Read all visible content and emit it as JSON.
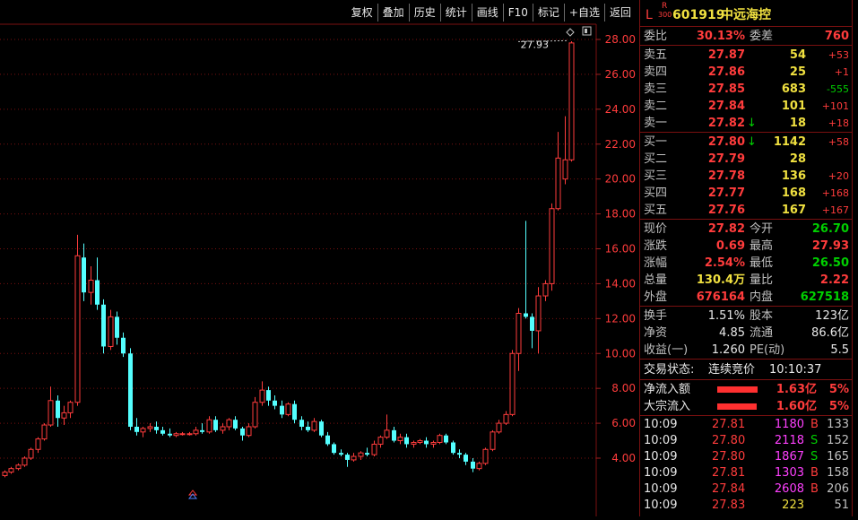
{
  "toolbar": {
    "items": [
      "复权",
      "叠加",
      "历史",
      "统计",
      "画线",
      "F10",
      "标记",
      "+自选",
      "返回"
    ]
  },
  "chart": {
    "y_labels": [
      "28.00",
      "26.00",
      "24.00",
      "22.00",
      "20.00",
      "18.00",
      "16.00",
      "14.00",
      "12.00",
      "10.00",
      "8.00",
      "6.00",
      "4.00"
    ],
    "high_marker": "27.93",
    "up_color": "#ff3c3c",
    "down_color": "#54ffff"
  },
  "stock": {
    "l": "L",
    "r": "R",
    "r_sub": "300",
    "code": "601919",
    "name": "中远海控"
  },
  "order_ratio": {
    "label1": "委比",
    "value1": "30.13%",
    "label2": "委差",
    "value2": "760"
  },
  "asks": [
    {
      "label": "卖五",
      "price": "27.87",
      "volume": "54",
      "change": "+53",
      "arrow": ""
    },
    {
      "label": "卖四",
      "price": "27.86",
      "volume": "25",
      "change": "+1",
      "arrow": ""
    },
    {
      "label": "卖三",
      "price": "27.85",
      "volume": "683",
      "change": "-555",
      "arrow": ""
    },
    {
      "label": "卖二",
      "price": "27.84",
      "volume": "101",
      "change": "+101",
      "arrow": ""
    },
    {
      "label": "卖一",
      "price": "27.82",
      "volume": "18",
      "change": "+18",
      "arrow": "↓"
    }
  ],
  "bids": [
    {
      "label": "买一",
      "price": "27.80",
      "volume": "1142",
      "change": "+58",
      "arrow": "↓"
    },
    {
      "label": "买二",
      "price": "27.79",
      "volume": "28",
      "change": "",
      "arrow": ""
    },
    {
      "label": "买三",
      "price": "27.78",
      "volume": "136",
      "change": "+20",
      "arrow": ""
    },
    {
      "label": "买四",
      "price": "27.77",
      "volume": "168",
      "change": "+168",
      "arrow": ""
    },
    {
      "label": "买五",
      "price": "27.76",
      "volume": "167",
      "change": "+167",
      "arrow": ""
    }
  ],
  "quote": [
    {
      "l1": "现价",
      "v1": "27.82",
      "c1": "red",
      "l2": "今开",
      "v2": "26.70",
      "c2": "green"
    },
    {
      "l1": "涨跌",
      "v1": "0.69",
      "c1": "red",
      "l2": "最高",
      "v2": "27.93",
      "c2": "red"
    },
    {
      "l1": "涨幅",
      "v1": "2.54%",
      "c1": "red",
      "l2": "最低",
      "v2": "26.50",
      "c2": "green"
    },
    {
      "l1": "总量",
      "v1": "130.4万",
      "c1": "yellow",
      "l2": "量比",
      "v2": "2.22",
      "c2": "red"
    },
    {
      "l1": "外盘",
      "v1": "676164",
      "c1": "red",
      "l2": "内盘",
      "v2": "627518",
      "c2": "green"
    }
  ],
  "fundamentals": [
    {
      "l1": "换手",
      "v1": "1.51%",
      "l2": "股本",
      "v2": "123亿"
    },
    {
      "l1": "净资",
      "v1": "4.85",
      "l2": "流通",
      "v2": "86.6亿"
    },
    {
      "l1": "收益(一)",
      "v1": "1.260",
      "l2": "PE(动)",
      "v2": "5.5"
    }
  ],
  "status": {
    "label": "交易状态:",
    "value": "连续竞价",
    "time": "10:10:37"
  },
  "flows": [
    {
      "label": "净流入额",
      "amount": "1.63亿",
      "pct": "5%",
      "bar": 0.9
    },
    {
      "label": "大宗流入",
      "amount": "1.60亿",
      "pct": "5%",
      "bar": 0.88
    }
  ],
  "ticks": [
    {
      "time": "10:09",
      "price": "27.81",
      "vol": "1180",
      "side": "B",
      "count": "133"
    },
    {
      "time": "10:09",
      "price": "27.80",
      "vol": "2118",
      "side": "S",
      "count": "152"
    },
    {
      "time": "10:09",
      "price": "27.80",
      "vol": "1867",
      "side": "S",
      "count": "165"
    },
    {
      "time": "10:09",
      "price": "27.81",
      "vol": "1303",
      "side": "B",
      "count": "158"
    },
    {
      "time": "10:09",
      "price": "27.84",
      "vol": "2608",
      "side": "B",
      "count": "206"
    },
    {
      "time": "10:09",
      "price": "27.83",
      "vol": "223",
      "side": "",
      "count": "51"
    }
  ],
  "candles": [
    {
      "o": 3.0,
      "h": 3.3,
      "l": 2.9,
      "c": 3.2
    },
    {
      "o": 3.2,
      "h": 3.5,
      "l": 3.1,
      "c": 3.4
    },
    {
      "o": 3.4,
      "h": 3.7,
      "l": 3.3,
      "c": 3.6
    },
    {
      "o": 3.6,
      "h": 4.1,
      "l": 3.5,
      "c": 4.0
    },
    {
      "o": 4.0,
      "h": 4.6,
      "l": 3.9,
      "c": 4.5
    },
    {
      "o": 4.5,
      "h": 5.2,
      "l": 4.3,
      "c": 5.1
    },
    {
      "o": 5.1,
      "h": 6.0,
      "l": 5.0,
      "c": 5.9
    },
    {
      "o": 5.9,
      "h": 8.1,
      "l": 5.8,
      "c": 7.3
    },
    {
      "o": 7.3,
      "h": 7.6,
      "l": 5.8,
      "c": 6.3
    },
    {
      "o": 6.3,
      "h": 7.0,
      "l": 5.9,
      "c": 6.6
    },
    {
      "o": 6.6,
      "h": 7.3,
      "l": 6.3,
      "c": 7.2
    },
    {
      "o": 7.2,
      "h": 16.8,
      "l": 7.0,
      "c": 15.6
    },
    {
      "o": 15.5,
      "h": 16.3,
      "l": 13.0,
      "c": 13.5
    },
    {
      "o": 13.5,
      "h": 15.0,
      "l": 12.8,
      "c": 14.2
    },
    {
      "o": 14.2,
      "h": 15.5,
      "l": 12.5,
      "c": 12.8
    },
    {
      "o": 12.8,
      "h": 13.1,
      "l": 10.0,
      "c": 10.4
    },
    {
      "o": 10.4,
      "h": 12.5,
      "l": 10.2,
      "c": 12.1
    },
    {
      "o": 12.1,
      "h": 12.4,
      "l": 10.5,
      "c": 10.9
    },
    {
      "o": 10.9,
      "h": 11.2,
      "l": 9.8,
      "c": 10.0
    },
    {
      "o": 10.0,
      "h": 10.3,
      "l": 5.6,
      "c": 5.8
    },
    {
      "o": 5.8,
      "h": 6.3,
      "l": 5.3,
      "c": 5.5
    },
    {
      "o": 5.5,
      "h": 5.8,
      "l": 5.2,
      "c": 5.7
    },
    {
      "o": 5.7,
      "h": 6.0,
      "l": 5.5,
      "c": 5.8
    },
    {
      "o": 5.8,
      "h": 6.1,
      "l": 5.4,
      "c": 5.6
    },
    {
      "o": 5.6,
      "h": 5.8,
      "l": 5.3,
      "c": 5.4
    },
    {
      "o": 5.4,
      "h": 5.7,
      "l": 5.2,
      "c": 5.3
    },
    {
      "o": 5.3,
      "h": 5.5,
      "l": 5.2,
      "c": 5.4
    },
    {
      "o": 5.4,
      "h": 5.5,
      "l": 5.3,
      "c": 5.4
    },
    {
      "o": 5.4,
      "h": 5.5,
      "l": 5.3,
      "c": 5.4
    },
    {
      "o": 5.4,
      "h": 5.8,
      "l": 5.3,
      "c": 5.6
    },
    {
      "o": 5.6,
      "h": 6.0,
      "l": 5.4,
      "c": 5.5
    },
    {
      "o": 5.5,
      "h": 6.4,
      "l": 5.4,
      "c": 6.2
    },
    {
      "o": 6.2,
      "h": 6.4,
      "l": 5.5,
      "c": 5.6
    },
    {
      "o": 5.6,
      "h": 6.0,
      "l": 5.4,
      "c": 5.8
    },
    {
      "o": 5.8,
      "h": 6.3,
      "l": 5.6,
      "c": 6.2
    },
    {
      "o": 6.2,
      "h": 6.4,
      "l": 5.6,
      "c": 5.7
    },
    {
      "o": 5.7,
      "h": 5.8,
      "l": 5.0,
      "c": 5.3
    },
    {
      "o": 5.3,
      "h": 6.0,
      "l": 5.2,
      "c": 5.8
    },
    {
      "o": 5.8,
      "h": 7.5,
      "l": 5.7,
      "c": 7.2
    },
    {
      "o": 7.2,
      "h": 8.4,
      "l": 7.0,
      "c": 7.9
    },
    {
      "o": 7.9,
      "h": 8.1,
      "l": 7.0,
      "c": 7.3
    },
    {
      "o": 7.3,
      "h": 7.6,
      "l": 6.8,
      "c": 7.0
    },
    {
      "o": 7.0,
      "h": 7.3,
      "l": 6.3,
      "c": 6.5
    },
    {
      "o": 6.5,
      "h": 7.2,
      "l": 6.4,
      "c": 7.1
    },
    {
      "o": 7.1,
      "h": 7.3,
      "l": 6.0,
      "c": 6.2
    },
    {
      "o": 6.2,
      "h": 6.4,
      "l": 5.6,
      "c": 5.8
    },
    {
      "o": 5.8,
      "h": 6.1,
      "l": 5.5,
      "c": 5.6
    },
    {
      "o": 5.6,
      "h": 6.3,
      "l": 5.5,
      "c": 6.1
    },
    {
      "o": 6.1,
      "h": 6.2,
      "l": 5.2,
      "c": 5.3
    },
    {
      "o": 5.3,
      "h": 5.5,
      "l": 4.7,
      "c": 4.8
    },
    {
      "o": 4.8,
      "h": 4.9,
      "l": 4.2,
      "c": 4.3
    },
    {
      "o": 4.3,
      "h": 4.5,
      "l": 4.1,
      "c": 4.2
    },
    {
      "o": 4.2,
      "h": 4.3,
      "l": 3.5,
      "c": 3.9
    },
    {
      "o": 3.9,
      "h": 4.3,
      "l": 3.8,
      "c": 4.1
    },
    {
      "o": 4.1,
      "h": 4.4,
      "l": 3.9,
      "c": 4.3
    },
    {
      "o": 4.3,
      "h": 4.6,
      "l": 4.1,
      "c": 4.2
    },
    {
      "o": 4.2,
      "h": 5.0,
      "l": 4.1,
      "c": 4.8
    },
    {
      "o": 4.8,
      "h": 5.3,
      "l": 4.6,
      "c": 5.2
    },
    {
      "o": 5.2,
      "h": 6.5,
      "l": 5.1,
      "c": 5.6
    },
    {
      "o": 5.6,
      "h": 5.8,
      "l": 4.9,
      "c": 5.0
    },
    {
      "o": 5.0,
      "h": 5.4,
      "l": 4.8,
      "c": 5.2
    },
    {
      "o": 5.2,
      "h": 5.4,
      "l": 4.6,
      "c": 4.8
    },
    {
      "o": 4.8,
      "h": 5.0,
      "l": 4.6,
      "c": 4.9
    },
    {
      "o": 4.9,
      "h": 5.1,
      "l": 4.8,
      "c": 5.0
    },
    {
      "o": 5.0,
      "h": 5.2,
      "l": 4.6,
      "c": 4.8
    },
    {
      "o": 4.8,
      "h": 5.0,
      "l": 4.6,
      "c": 4.9
    },
    {
      "o": 4.9,
      "h": 5.4,
      "l": 4.8,
      "c": 5.3
    },
    {
      "o": 5.3,
      "h": 5.4,
      "l": 4.8,
      "c": 4.9
    },
    {
      "o": 4.9,
      "h": 5.0,
      "l": 4.2,
      "c": 4.3
    },
    {
      "o": 4.3,
      "h": 4.5,
      "l": 4.0,
      "c": 4.2
    },
    {
      "o": 4.2,
      "h": 4.3,
      "l": 3.6,
      "c": 3.8
    },
    {
      "o": 3.8,
      "h": 4.0,
      "l": 3.2,
      "c": 3.4
    },
    {
      "o": 3.4,
      "h": 3.8,
      "l": 3.3,
      "c": 3.7
    },
    {
      "o": 3.7,
      "h": 4.6,
      "l": 3.6,
      "c": 4.5
    },
    {
      "o": 4.5,
      "h": 5.6,
      "l": 4.4,
      "c": 5.5
    },
    {
      "o": 5.5,
      "h": 6.2,
      "l": 5.4,
      "c": 6.0
    },
    {
      "o": 6.0,
      "h": 6.7,
      "l": 5.9,
      "c": 6.5
    },
    {
      "o": 6.5,
      "h": 10.2,
      "l": 6.4,
      "c": 10.0
    },
    {
      "o": 10.0,
      "h": 12.6,
      "l": 9.0,
      "c": 12.3
    },
    {
      "o": 12.3,
      "h": 17.6,
      "l": 12.0,
      "c": 12.1
    },
    {
      "o": 12.1,
      "h": 12.3,
      "l": 10.3,
      "c": 11.3
    },
    {
      "o": 11.3,
      "h": 13.8,
      "l": 10.0,
      "c": 13.3
    },
    {
      "o": 13.3,
      "h": 14.2,
      "l": 13.0,
      "c": 14.0
    },
    {
      "o": 14.0,
      "h": 18.6,
      "l": 13.6,
      "c": 18.3
    },
    {
      "o": 18.3,
      "h": 22.7,
      "l": 18.2,
      "c": 21.2
    },
    {
      "o": 20.0,
      "h": 23.6,
      "l": 19.7,
      "c": 21.1
    },
    {
      "o": 21.1,
      "h": 27.9,
      "l": 21.0,
      "c": 27.8
    }
  ]
}
